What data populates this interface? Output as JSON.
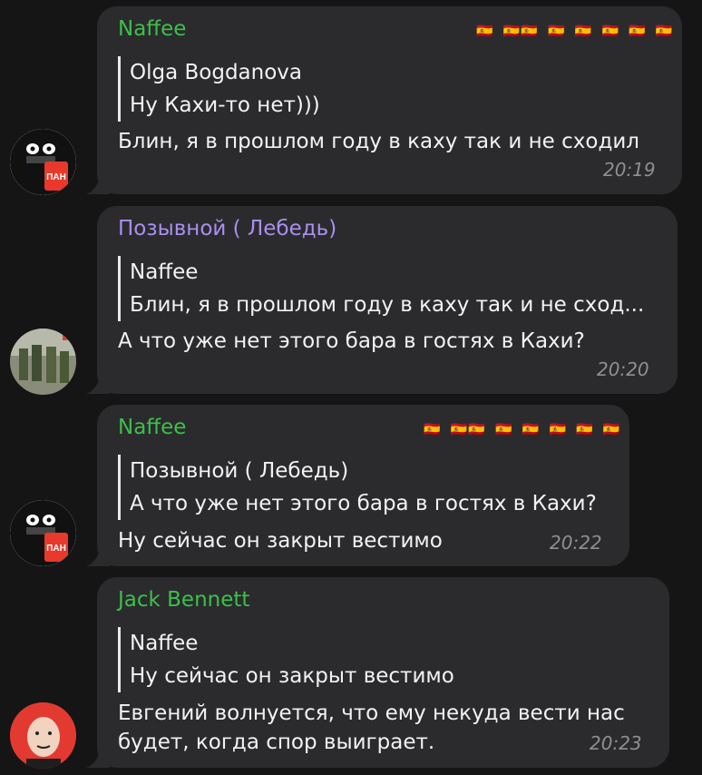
{
  "messages": [
    {
      "author": "Naffee",
      "author_color": "#3cc04a",
      "signature": "🇪🇸 🇪🇸🇪🇸 🇪🇸 🇪🇸 🇪🇸 🇪🇸 🇪🇸",
      "reply_author": "Olga Bogdanova",
      "reply_text": "Ну Кахи-то нет)))",
      "text_lines": [
        "Блин, я в прошлом году в каху так и не сходил"
      ],
      "time": "20:19",
      "avatar": "cat-avatar"
    },
    {
      "author": "Позывной ( Лебедь)",
      "author_color": "#a98ff0",
      "reply_author": "Naffee",
      "reply_text": "Блин, я в прошлом году в каху так и не сход...",
      "text_lines": [
        "А что уже нет этого бара в гостях в Кахи?"
      ],
      "time": "20:20",
      "avatar": "group-photo-avatar"
    },
    {
      "author": "Naffee",
      "author_color": "#3cc04a",
      "signature": "🇪🇸 🇪🇸🇪🇸 🇪🇸 🇪🇸 🇪🇸 🇪🇸 🇪🇸",
      "reply_author": "Позывной ( Лебедь)",
      "reply_text": "А что уже нет этого бара в гостях в Кахи?",
      "text_lines": [
        "Ну сейчас он закрыт вестимо"
      ],
      "time": "20:22",
      "avatar": "cat-avatar"
    },
    {
      "author": "Jack Bennett",
      "author_color": "#3cc04a",
      "reply_author": "Naffee",
      "reply_text": "Ну сейчас он закрыт вестимо",
      "text_lines": [
        "Евгений волнуется, что ему некуда вести нас",
        "будет, когда спор выиграет."
      ],
      "time": "20:23",
      "avatar": "caricature-avatar"
    }
  ]
}
